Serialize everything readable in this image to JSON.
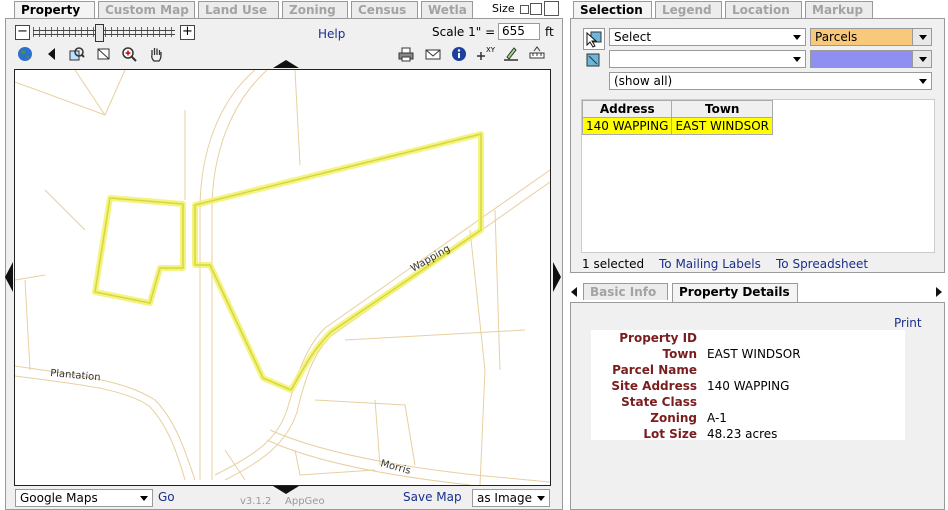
{
  "left_tabs": [
    {
      "label": "Property",
      "active": true
    },
    {
      "label": "Custom Map",
      "active": false
    },
    {
      "label": "Land Use",
      "active": false
    },
    {
      "label": "Zoning",
      "active": false
    },
    {
      "label": "Census",
      "active": false
    },
    {
      "label": "Wetla",
      "active": false
    }
  ],
  "size": {
    "label": "Size"
  },
  "toolbar": {
    "help": "Help",
    "scale_label": "Scale 1\" =",
    "scale_value": "655",
    "scale_unit": "ft"
  },
  "map": {
    "street_labels": [
      "Wapping",
      "Plantation",
      "Morris"
    ],
    "basemap_value": "Google Maps",
    "go": "Go",
    "version": "v3.1.2",
    "brand": "AppGeo",
    "save_map": "Save Map",
    "save_format": "as Image",
    "highlight_color": "#f2f26b",
    "road_color": "#e8cfa0"
  },
  "right_tabs": [
    {
      "label": "Selection",
      "active": true
    },
    {
      "label": "Legend",
      "active": false
    },
    {
      "label": "Location",
      "active": false
    },
    {
      "label": "Markup",
      "active": false
    }
  ],
  "selection": {
    "mode": "Select",
    "layer": "Parcels",
    "second_select": "",
    "filter": "(show all)",
    "layer_color": "#f8c97a",
    "second_color": "#8f8ff2",
    "table_headers": [
      "Address",
      "Town"
    ],
    "rows": [
      [
        "140 WAPPING",
        "EAST WINDSOR"
      ]
    ],
    "row_highlight": "#ffff00",
    "count_text": "1 selected",
    "mailing_labels": "To Mailing Labels",
    "spreadsheet": "To Spreadsheet"
  },
  "detail_tabs": [
    {
      "label": "Basic Info",
      "active": false
    },
    {
      "label": "Property Details",
      "active": true
    }
  ],
  "details": {
    "print": "Print",
    "fields": [
      {
        "label": "Property ID",
        "value": ""
      },
      {
        "label": "Town",
        "value": "EAST WINDSOR"
      },
      {
        "label": "Parcel Name",
        "value": ""
      },
      {
        "label": "Site Address",
        "value": "140 WAPPING"
      },
      {
        "label": "State Class",
        "value": ""
      },
      {
        "label": "Zoning",
        "value": "A-1"
      },
      {
        "label": "Lot Size",
        "value": "48.23 acres"
      }
    ]
  }
}
